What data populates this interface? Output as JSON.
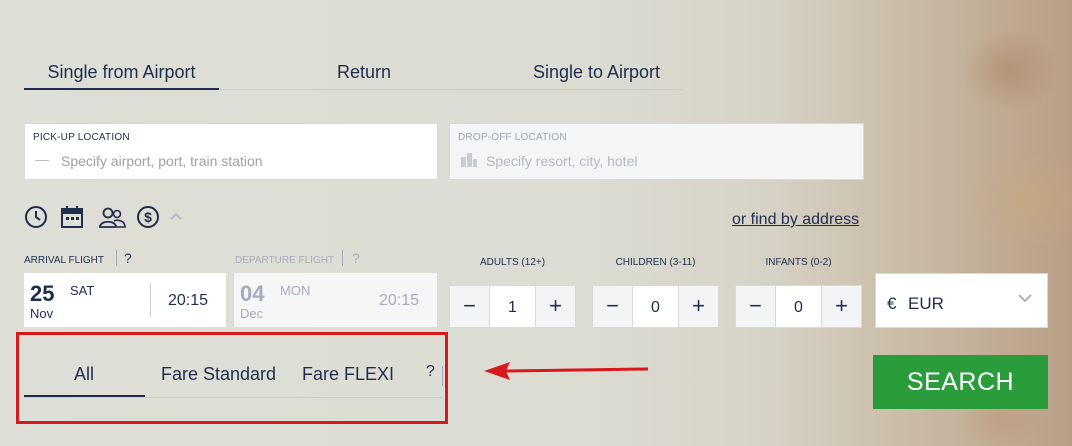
{
  "tabs": [
    {
      "label": "Single from Airport",
      "active": true
    },
    {
      "label": "Return",
      "active": false
    },
    {
      "label": "Single to Airport",
      "active": false
    }
  ],
  "pickup": {
    "label": "PICK-UP LOCATION",
    "placeholder": "Specify airport, port, train station",
    "icon": "minus-icon"
  },
  "dropoff": {
    "label": "DROP-OFF LOCATION",
    "placeholder": "Specify resort, city, hotel",
    "icon": "buildings-icon"
  },
  "options_icons": [
    "clock-icon",
    "calendar-icon",
    "people-icon",
    "dollar-icon",
    "chevron-up-icon"
  ],
  "find_by_address": "or find by address",
  "arrival": {
    "label": "ARRIVAL FLIGHT",
    "help": "?",
    "day": "25",
    "dow": "SAT",
    "month": "Nov",
    "time": "20:15"
  },
  "departure": {
    "label": "DEPARTURE FLIGHT",
    "help": "?",
    "day": "04",
    "dow": "MON",
    "month": "Dec",
    "time": "20:15"
  },
  "passengers": {
    "adults": {
      "label": "ADULTS (12+)",
      "value": "1"
    },
    "children": {
      "label": "CHILDREN (3-11)",
      "value": "0"
    },
    "infants": {
      "label": "INFANTS (0-2)",
      "value": "0"
    },
    "minus": "−",
    "plus": "+"
  },
  "currency": {
    "symbol": "€",
    "code": "EUR"
  },
  "fares": {
    "items": [
      "All",
      "Fare Standard",
      "Fare FLEXI"
    ],
    "help": "?"
  },
  "search_label": "SEARCH",
  "colors": {
    "navy": "#1f2d4f",
    "search_green": "#2b9c3c",
    "annotation_red": "#d6191d"
  }
}
